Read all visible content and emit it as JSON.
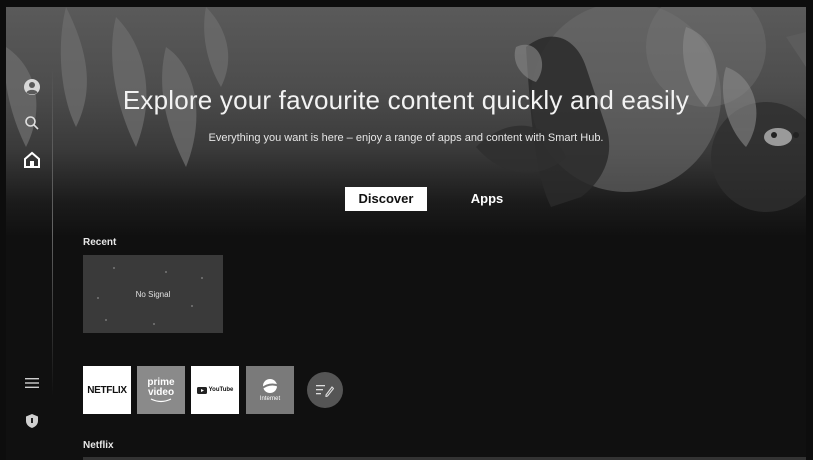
{
  "hero": {
    "title": "Explore your favourite content quickly and easily",
    "subtitle": "Everything you want is here – enjoy a range of apps and content with Smart Hub."
  },
  "tabs": [
    {
      "label": "Discover",
      "selected": true
    },
    {
      "label": "Apps",
      "selected": false
    }
  ],
  "sidebar": {
    "icons": [
      "profile-icon",
      "search-icon",
      "home-icon",
      "menu-icon",
      "privacy-icon"
    ],
    "active": "home-icon"
  },
  "recent": {
    "label": "Recent",
    "tile_text": "No Signal"
  },
  "apps": [
    {
      "name": "NETFLIX"
    },
    {
      "name_line1": "prime",
      "name_line2": "video"
    },
    {
      "name": "YouTube"
    },
    {
      "name": "Internet"
    }
  ],
  "netflix_row": {
    "label": "Netflix"
  },
  "colors": {
    "background": "#101010",
    "tab_selected_bg": "#ffffff",
    "tab_selected_text": "#111111"
  }
}
